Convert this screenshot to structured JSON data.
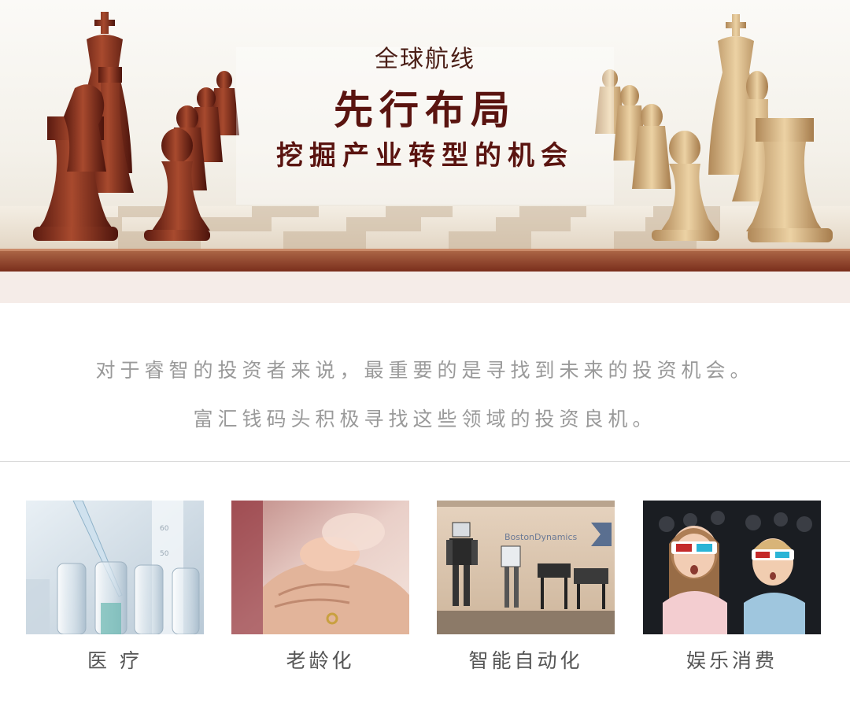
{
  "hero": {
    "kicker": "全球航线",
    "title": "先行布局",
    "subtitle": "挖掘产业转型的机会"
  },
  "intro": {
    "line1": "对于睿智的投资者来说，最重要的是寻找到未来的投资机会。",
    "line2": "富汇钱码头积极寻找这些领域的投资良机。"
  },
  "categories": [
    {
      "label": "医 疗",
      "image": "lab-test-tubes"
    },
    {
      "label": "老龄化",
      "image": "elderly-hand-with-baby-hand"
    },
    {
      "label": "智能自动化",
      "image": "robots",
      "sign_text": "BostonDynamics"
    },
    {
      "label": "娱乐消费",
      "image": "children-3d-glasses-cinema"
    }
  ],
  "colors": {
    "title": "#5a1410",
    "intro_text": "#9a9a9a",
    "label_text": "#555555",
    "band": "#f5ece8"
  }
}
